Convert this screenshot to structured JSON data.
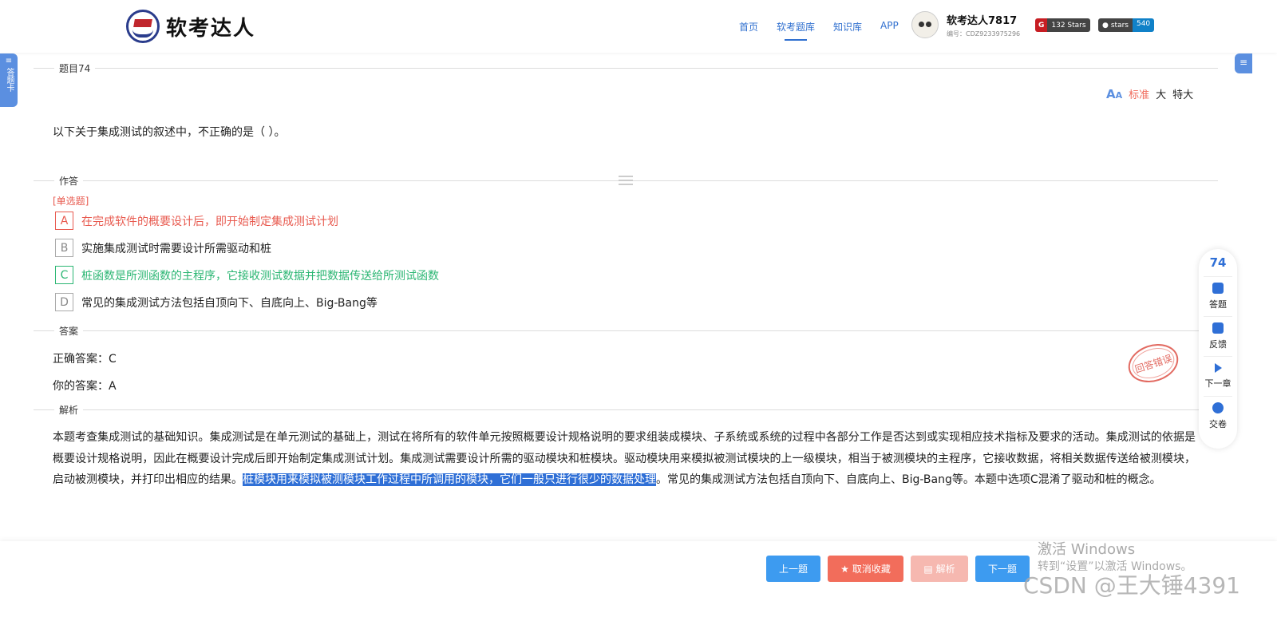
{
  "header": {
    "logo_text": "软考达人",
    "nav": [
      "首页",
      "软考题库",
      "知识库",
      "APP"
    ],
    "user_name": "软考达人7817",
    "user_id": "编号：CDZ9233975296",
    "badge_gitee": "132 Stars",
    "badge_github_label": "stars",
    "badge_github_count": "540"
  },
  "side": {
    "answer_card": "答题卡"
  },
  "question": {
    "section_title": "题目74",
    "font_sizes": [
      "标准",
      "大",
      "特大"
    ],
    "text": "以下关于集成测试的叙述中，不正确的是（ ）。"
  },
  "answer_area": {
    "section_title": "作答",
    "type": "[单选题]",
    "options": [
      {
        "key": "A",
        "text": "在完成软件的概要设计后，即开始制定集成测试计划"
      },
      {
        "key": "B",
        "text": "实施集成测试时需要设计所需驱动和桩"
      },
      {
        "key": "C",
        "text": "桩函数是所测函数的主程序，它接收测试数据并把数据传送给所测试函数"
      },
      {
        "key": "D",
        "text": "常见的集成测试方法包括自顶向下、自底向上、Big-Bang等"
      }
    ]
  },
  "answer": {
    "section_title": "答案",
    "correct": "正确答案：C",
    "yours": "你的答案：A",
    "stamp": "回答错误"
  },
  "analysis": {
    "section_title": "解析",
    "text_before": "本题考查集成测试的基础知识。集成测试是在单元测试的基础上，测试在将所有的软件单元按照概要设计规格说明的要求组装成模块、子系统或系统的过程中各部分工作是否达到或实现相应技术指标及要求的活动。集成测试的依据是概要设计规格说明，因此在概要设计完成后即开始制定集成测试计划。集成测试需要设计所需的驱动模块和桩模块。驱动模块用来模拟被测试模块的上一级模块，相当于被测模块的主程序，它接收数据，将相关数据传送给被测模块，启动被测模块，并打印出相应的结果。",
    "text_selected": "桩模块用来模拟被测模块工作过程中所调用的模块，它们一般只进行很少的数据处理",
    "text_after": "。常见的集成测试方法包括自顶向下、自底向上、Big-Bang等。本题中选项C混淆了驱动和桩的概念。"
  },
  "rightbar": {
    "number": "74",
    "items": [
      "答题",
      "反馈",
      "下一章",
      "交卷"
    ]
  },
  "buttons": {
    "prev": "上一题",
    "unfav": "取消收藏",
    "analysis": "解析",
    "next": "下一题"
  },
  "watermarks": {
    "activate_title": "激活 Windows",
    "activate_sub": "转到“设置”以激活 Windows。",
    "csdn": "CSDN @王大锤4391"
  },
  "colors": {
    "accent": "#2f6fd6",
    "wrong": "#e85a4f",
    "right": "#2bb673"
  }
}
